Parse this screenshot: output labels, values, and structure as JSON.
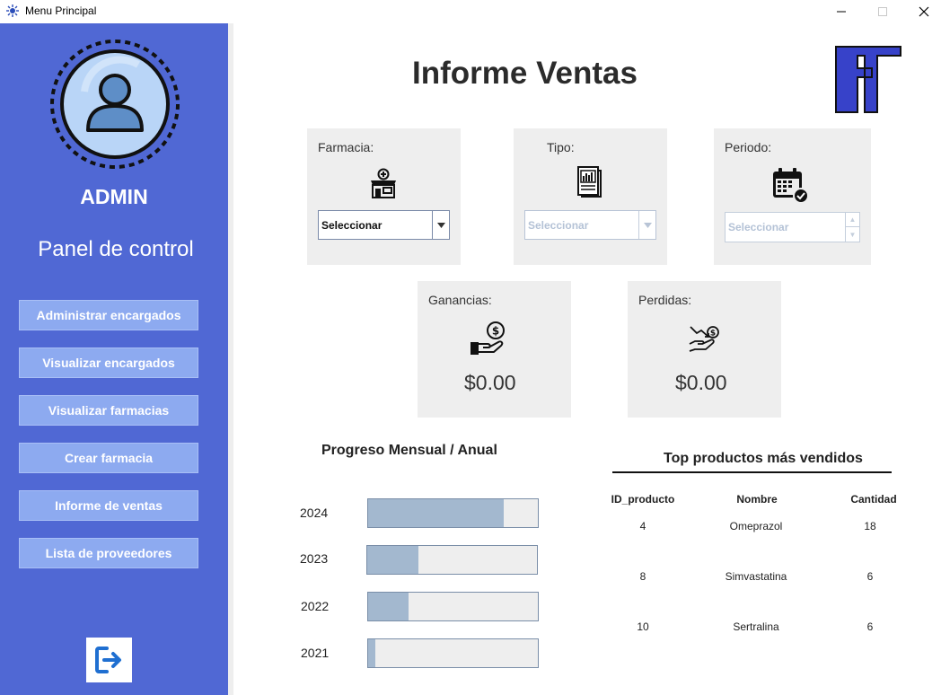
{
  "window": {
    "title": "Menu Principal"
  },
  "sidebar": {
    "user": "ADMIN",
    "panel_title": "Panel de control",
    "items": [
      {
        "label": "Administrar encargados"
      },
      {
        "label": "Visualizar encargados"
      },
      {
        "label": "Visualizar farmacias"
      },
      {
        "label": "Crear farmacia"
      },
      {
        "label": "Informe de ventas"
      },
      {
        "label": "Lista de proveedores"
      }
    ]
  },
  "main": {
    "title": "Informe Ventas",
    "filters": {
      "farmacia": {
        "label": "Farmacia:",
        "value": "Seleccionar"
      },
      "tipo": {
        "label": "Tipo:",
        "value": "Seleccionar"
      },
      "periodo": {
        "label": "Periodo:",
        "value": "Seleccionar"
      }
    },
    "ganancias": {
      "label": "Ganancias:",
      "value": "$0.00"
    },
    "perdidas": {
      "label": "Perdidas:",
      "value": "$0.00"
    },
    "progress": {
      "title": "Progreso Mensual / Anual",
      "rows": [
        {
          "year": "2024",
          "progress": 0.8
        },
        {
          "year": "2023",
          "progress": 0.3
        },
        {
          "year": "2022",
          "progress": 0.24
        },
        {
          "year": "2021",
          "progress": 0.04
        }
      ]
    },
    "top_products": {
      "title": "Top productos más vendidos",
      "columns": [
        "ID_producto",
        "Nombre",
        "Cantidad"
      ],
      "rows": [
        [
          "4",
          "Omeprazol",
          "18"
        ],
        [
          "8",
          "Simvastatina",
          "6"
        ],
        [
          "10",
          "Sertralina",
          "6"
        ]
      ]
    }
  },
  "colors": {
    "sidebar": "#5068d4",
    "nav_button": "#8daaf0",
    "progress_fill": "#a3b8cf",
    "logo": "#3742c9"
  }
}
